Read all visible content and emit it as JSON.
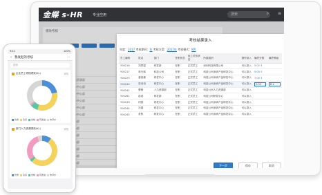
{
  "app": {
    "brand": "金蝶 s-HR",
    "menu": "专业应用",
    "search_placeholder": "搜索"
  },
  "bg": {
    "page_title": "绩效考核",
    "columns": [
      "姓名",
      "部门"
    ],
    "rows": [
      [
        "张三",
        "公司人力资源部"
      ],
      [
        "李四",
        "评估中心中心部"
      ],
      [
        "林行辉",
        "评估中心中心部"
      ],
      [
        "曾俊峰",
        "评估中心中心部"
      ],
      [
        "张诗",
        "评估中心中心部"
      ],
      [
        "赵云",
        "评估中心中心部"
      ],
      [
        "何燕",
        "研发中心部"
      ],
      [
        "冯娟",
        "研发中心部"
      ],
      [
        "高翔",
        "研发中心部"
      ],
      [
        "刘欢",
        "研发中心部"
      ],
      [
        "吴倩",
        "研发中心部"
      ],
      [
        "王明",
        "研发中心部"
      ],
      [
        "陈龙",
        "研发中心部"
      ],
      [
        "周丽",
        "研发中心部"
      ]
    ]
  },
  "dialog": {
    "title": "考核结果录入",
    "filter": {
      "y_label": "年度：",
      "year": "2017",
      "p_label": "考核期间：",
      "period": "年",
      "a_label": "考核方案：",
      "plan": "2017年",
      "m_label": "考核模式：",
      "mode": "KPI"
    },
    "columns": [
      "员工编码",
      "姓名",
      "部门",
      "任职状态",
      "用工关系状态",
      "所属组织",
      "操作录入",
      "最终分数",
      "最终等级"
    ],
    "rows": [
      [
        "Y00216",
        "刘思强",
        "研发部",
        "在职",
        "正式员工",
        "深圳科技有限公司",
        "可以录入",
        "5.02 5",
        ""
      ],
      [
        "Y00217",
        "林行辉",
        "科技公司",
        "在职",
        "正式员工",
        "科技公司深圳产品研发中心",
        "可以录入",
        "5.00 5",
        ""
      ],
      [
        "Y00229",
        "曾俊峰",
        "研发中心",
        "在职",
        "正式员工",
        "科技公司深圳产品研发中心",
        "可以录入",
        "7.00 3",
        ""
      ],
      [
        "Y00240",
        "张诗诗",
        "研发中心",
        "在职",
        "正式员工",
        "科技公司深圳产品研发中心",
        "可以录入",
        "",
        ""
      ],
      [
        "Y00241",
        "曹畅",
        "人力资源部",
        "在职",
        "正式员工",
        "科技公司人力资源部",
        "可以录入",
        "",
        ""
      ],
      [
        "Y00262",
        "赵培",
        "研发部",
        "在职",
        "正式员工",
        "科技公司研发中心",
        "可以录入",
        "",
        ""
      ],
      [
        "Y00243",
        "何燕",
        "研发中心",
        "在职",
        "正式员工",
        "科技公司深圳产品研发中心",
        "可以录入",
        "",
        ""
      ],
      [
        "Y00244",
        "冯娟",
        "研发中心",
        "在职",
        "正式员工",
        "科技公司深圳产品研发中心",
        "可以录入",
        "",
        ""
      ],
      [
        "Y00245",
        "老陈",
        "研发中心",
        "在职",
        "正式员工",
        "科技公司深圳产品研发中心",
        "可以录入",
        "",
        ""
      ]
    ],
    "edit_row": {
      "score": "5.00",
      "grade": "B"
    },
    "btn_next": "下一步",
    "btn_save": "保存",
    "btn_cancel": "取消"
  },
  "phone": {
    "status_time": "9:41",
    "status_battery": "100%",
    "nav_title": "我发起的考核",
    "more": "···",
    "search_placeholder": "搜索",
    "card1": {
      "title": "企业员工考核绩效(KL)",
      "sub": "详情"
    },
    "card2": {
      "title": "部门人力资源绩效(KL)",
      "sub": "详情"
    },
    "legend": [
      "优秀",
      "良好",
      "合格",
      "待改进",
      "未评价"
    ],
    "colors": {
      "blue": "#4a90d9",
      "yellow": "#f3d35b",
      "green": "#5cc4a3",
      "pink": "#f29ac0",
      "gray": "#d6d6d6"
    }
  }
}
